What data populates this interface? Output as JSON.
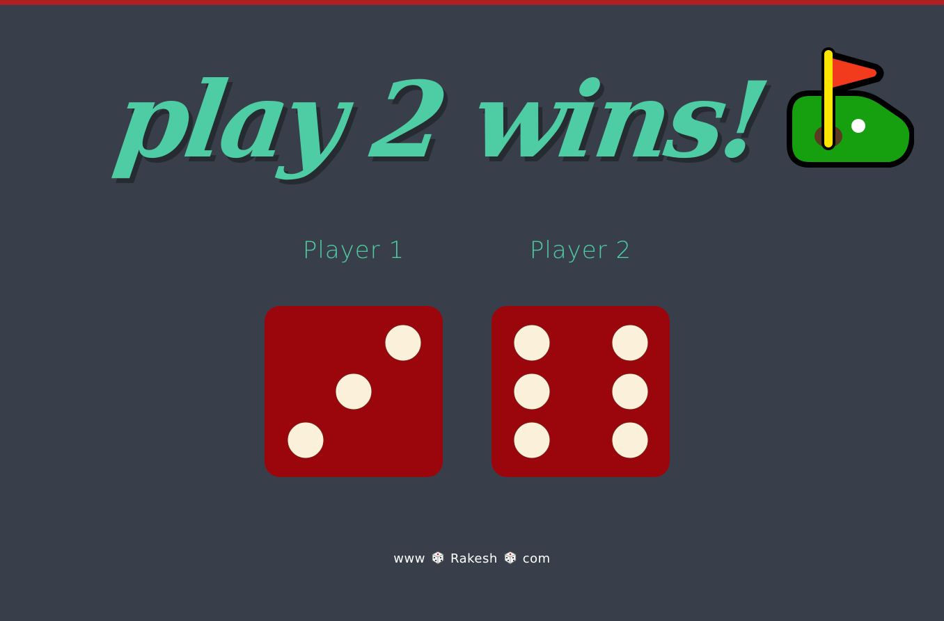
{
  "header": {
    "title": "play 2 wins!",
    "icon": "golf-flag-icon"
  },
  "players": [
    {
      "label": "Player 1",
      "die_value": 3
    },
    {
      "label": "Player 2",
      "die_value": 6
    }
  ],
  "footer": {
    "part1": "www",
    "part2": "Rakesh",
    "part3": "com",
    "separator_icon": "dice-icon"
  },
  "colors": {
    "background": "#393f4a",
    "accent": "#4ecca3",
    "top_bar": "#ae1f24",
    "die_face": "#9b060d",
    "die_pip": "#fbf0da"
  }
}
